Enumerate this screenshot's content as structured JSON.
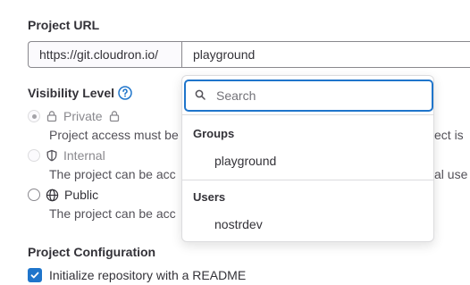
{
  "project_url": {
    "label": "Project URL",
    "prefix": "https://git.cloudron.io/",
    "namespace_value": "playground"
  },
  "visibility": {
    "label": "Visibility Level",
    "options": [
      {
        "label": "Private",
        "description": "Project access must be",
        "description_tail": "ect is",
        "disabled": true,
        "selected": true
      },
      {
        "label": "Internal",
        "description": "The project can be acc",
        "description_tail": "al use",
        "disabled": true,
        "selected": false
      },
      {
        "label": "Public",
        "description": "The project can be acc",
        "disabled": false,
        "selected": false
      }
    ]
  },
  "dropdown": {
    "search_placeholder": "Search",
    "groups_header": "Groups",
    "groups": [
      "playground"
    ],
    "users_header": "Users",
    "users": [
      "nostrdev"
    ]
  },
  "project_config": {
    "label": "Project Configuration",
    "readme_label": "Initialize repository with a README",
    "readme_checked": true
  },
  "colors": {
    "accent": "#1f75cb",
    "text": "#333238",
    "muted": "#89888d"
  }
}
